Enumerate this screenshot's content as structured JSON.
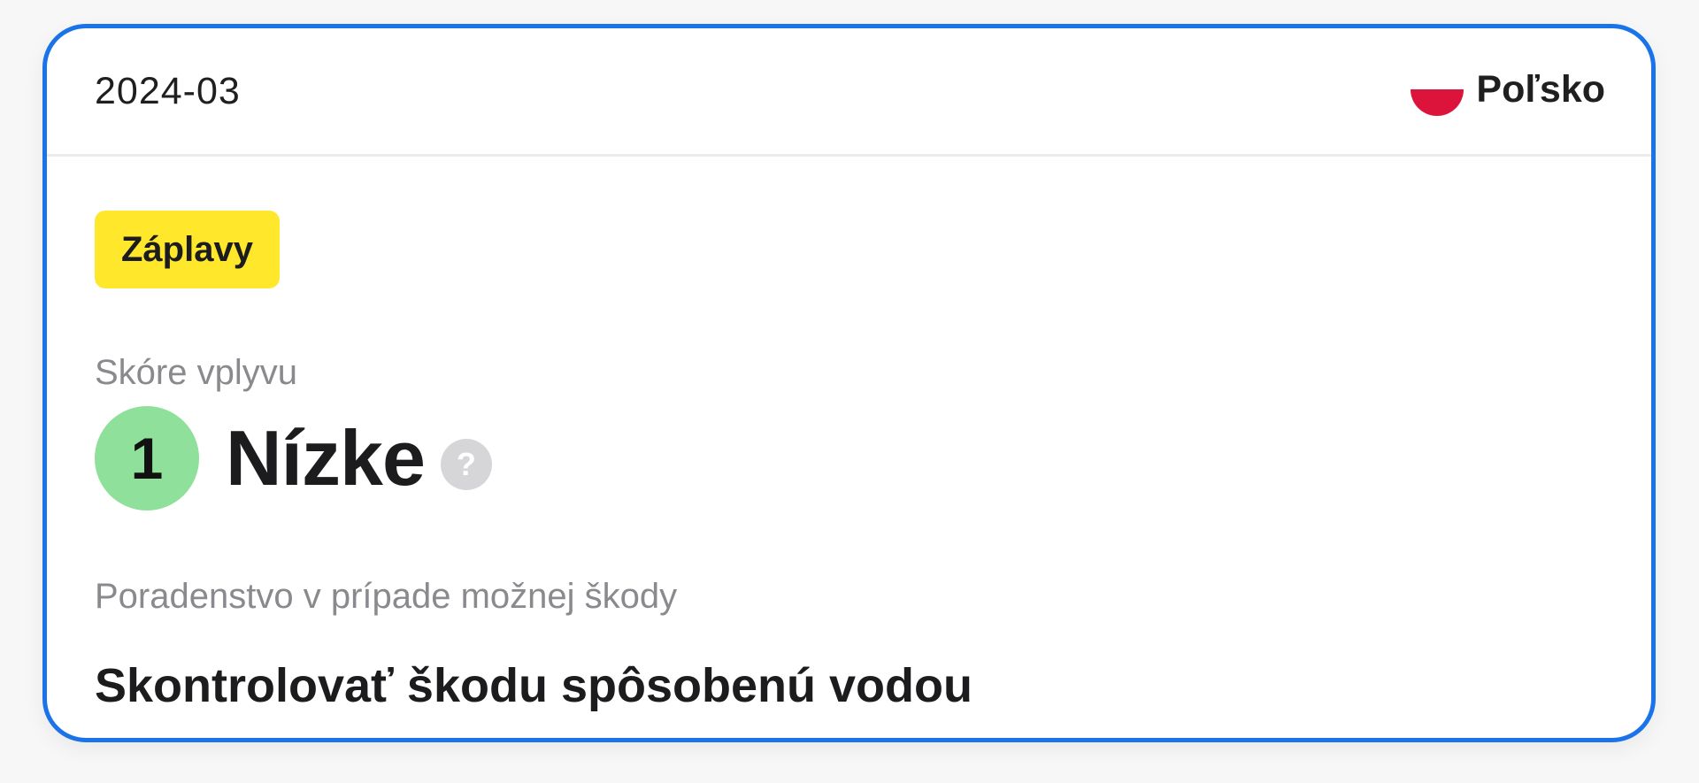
{
  "card": {
    "date": "2024-03",
    "country": {
      "name": "Poľsko",
      "flag_icon": "poland-flag-icon",
      "flag_colors": [
        "#ffffff",
        "#dc143c"
      ]
    },
    "category_badge": {
      "label": "Záplavy",
      "color": "#ffe82b"
    },
    "impact": {
      "label": "Skóre vplyvu",
      "score": "1",
      "level": "Nízke",
      "score_color": "#8ee09a",
      "help_icon": "question-mark-icon",
      "help_glyph": "?"
    },
    "advice": {
      "label": "Poradenstvo v prípade možnej škody",
      "text": "Skontrolovať škodu spôsobenú vodou"
    },
    "accent_color": "#1a73e8"
  }
}
